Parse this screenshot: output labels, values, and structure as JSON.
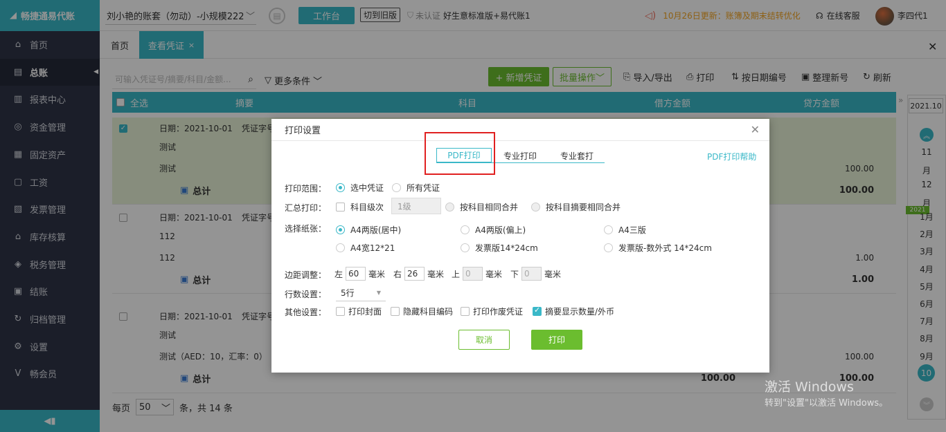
{
  "app": {
    "logo_text": "畅捷通易代账"
  },
  "sidebar": {
    "items": [
      {
        "label": "首页",
        "icon": "home-icon"
      },
      {
        "label": "总账",
        "icon": "ledger-icon",
        "active": true
      },
      {
        "label": "报表中心",
        "icon": "report-icon"
      },
      {
        "label": "资金管理",
        "icon": "fund-icon"
      },
      {
        "label": "固定资产",
        "icon": "asset-icon"
      },
      {
        "label": "工资",
        "icon": "salary-icon"
      },
      {
        "label": "发票管理",
        "icon": "invoice-icon"
      },
      {
        "label": "库存核算",
        "icon": "inventory-icon"
      },
      {
        "label": "税务管理",
        "icon": "tax-icon"
      },
      {
        "label": "结账",
        "icon": "checkout-icon"
      },
      {
        "label": "归档管理",
        "icon": "archive-icon"
      },
      {
        "label": "设置",
        "icon": "settings-icon"
      },
      {
        "label": "畅会员",
        "icon": "member-icon"
      }
    ]
  },
  "topbar": {
    "account": "刘小艳的账套（勿动）-小规模222",
    "workbench": "工作台",
    "old_version": "切到旧版",
    "cert": "未认证",
    "edition": "好生意标准版+易代账1",
    "notice": "10月26日更新：账簿及期末结转优化",
    "service": "在线客服",
    "user": "李四代1"
  },
  "tabs": {
    "home": "首页",
    "voucher": "查看凭证"
  },
  "toolbar": {
    "search_placeholder": "可输入凭证号/摘要/科目/金额...",
    "more": "更多条件",
    "new": "+ 新增凭证",
    "batch": "批量操作",
    "import_export": "导入/导出",
    "print": "打印",
    "by_date": "按日期编号",
    "renumber": "整理新号",
    "refresh": "刷新"
  },
  "table": {
    "headers": {
      "select_all": "全选",
      "summary": "摘要",
      "subject": "科目",
      "debit": "借方金额",
      "credit": "贷方金额"
    },
    "groups": [
      {
        "date": "日期：2021-10-01",
        "voucher": "凭证字号",
        "lines": [
          "测试",
          "测试"
        ],
        "amount": "100.00",
        "total_label": "总计",
        "total": "100.00",
        "total_debit": "",
        "checked": true
      },
      {
        "date": "日期：2021-10-01",
        "voucher": "凭证字号",
        "lines": [
          "112",
          "112"
        ],
        "amount": "1.00",
        "total_label": "总计",
        "total": "1.00",
        "total_debit": "",
        "checked": false
      },
      {
        "date": "日期：2021-10-01",
        "voucher": "凭证字号",
        "lines": [
          "测试",
          "测试（AED：10，汇率：0）"
        ],
        "amount": "100.00",
        "total_label": "总计",
        "total": "100.00",
        "total_debit": "100.00",
        "checked": false
      }
    ]
  },
  "pager": {
    "per_page": "每页",
    "size": "50",
    "total": "条，共 14 条"
  },
  "date_strip": {
    "year": "2021.10",
    "months_top": [
      "11",
      "月",
      "12",
      "月"
    ],
    "tag": "2021",
    "months": [
      "1月",
      "2月",
      "3月",
      "4月",
      "5月",
      "6月",
      "7月",
      "8月",
      "9月"
    ],
    "current": "10"
  },
  "modal": {
    "title": "打印设置",
    "tabs": [
      "PDF打印",
      "专业打印",
      "专业套打"
    ],
    "help": "PDF打印帮助",
    "range_label": "打印范围：",
    "range_options": [
      "选中凭证",
      "所有凭证"
    ],
    "summary_label": "汇总打印：",
    "summary_level": "科目级次",
    "summary_level_value": "1级",
    "summary_opt1": "按科目相同合并",
    "summary_opt2": "按科目摘要相同合并",
    "paper_label": "选择纸张：",
    "papers": [
      "A4两版(居中)",
      "A4两版(偏上)",
      "A4三版",
      "A4宽12*21",
      "发票版14*24cm",
      "发票版-数外式 14*24cm"
    ],
    "margin_label": "边距调整：",
    "margins": [
      {
        "side": "左",
        "value": "60",
        "unit": "毫米"
      },
      {
        "side": "右",
        "value": "26",
        "unit": "毫米"
      },
      {
        "side": "上",
        "value": "0",
        "unit": "毫米"
      },
      {
        "side": "下",
        "value": "0",
        "unit": "毫米"
      }
    ],
    "rows_label": "行数设置：",
    "rows_value": "5行",
    "other_label": "其他设置：",
    "others": [
      "打印封面",
      "隐藏科目编码",
      "打印作废凭证",
      "摘要显示数量/外币"
    ],
    "cancel": "取消",
    "print": "打印"
  },
  "watermark": {
    "line1": "激活 Windows",
    "line2": "转到\"设置\"以激活 Windows。"
  }
}
